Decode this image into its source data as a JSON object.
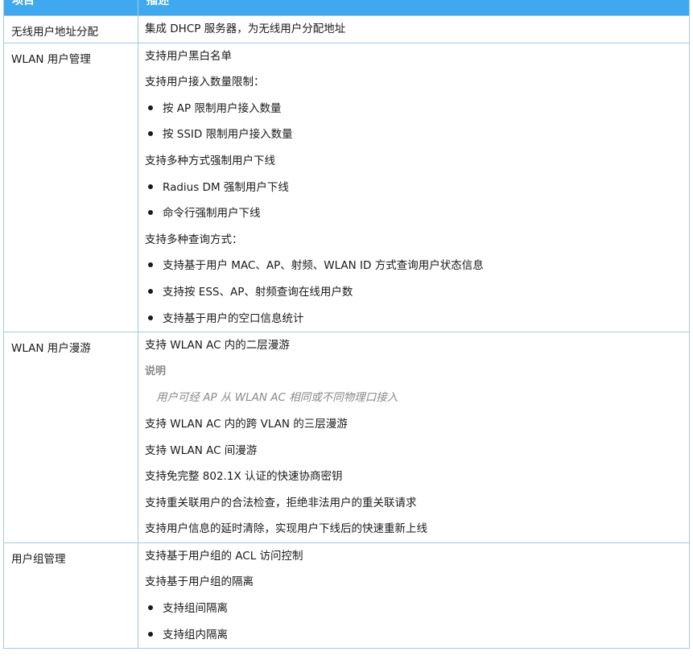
{
  "header": {
    "col_item": "项目",
    "col_desc": "描述"
  },
  "rows": [
    {
      "item": "无线用户地址分配",
      "lines": [
        {
          "type": "text",
          "text": "集成 DHCP 服务器，为无线用户分配地址"
        }
      ]
    },
    {
      "item": "WLAN 用户管理",
      "lines": [
        {
          "type": "text",
          "text": "支持用户黑白名单"
        },
        {
          "type": "text",
          "text": "支持用户接入数量限制："
        },
        {
          "type": "bullet",
          "text": "按 AP 限制用户接入数量"
        },
        {
          "type": "bullet",
          "text": "按 SSID 限制用户接入数量"
        },
        {
          "type": "text",
          "text": "支持多种方式强制用户下线"
        },
        {
          "type": "bullet",
          "text": "Radius DM 强制用户下线"
        },
        {
          "type": "bullet",
          "text": "命令行强制用户下线"
        },
        {
          "type": "text",
          "text": "支持多种查询方式："
        },
        {
          "type": "bullet",
          "text": "支持基于用户 MAC、AP、射频、WLAN ID 方式查询用户状态信息"
        },
        {
          "type": "bullet",
          "text": "支持按 ESS、AP、射频查询在线用户数"
        },
        {
          "type": "bullet",
          "text": "支持基于用户的空口信息统计"
        }
      ]
    },
    {
      "item": "WLAN 用户漫游",
      "lines": [
        {
          "type": "text",
          "text": "支持 WLAN AC 内的二层漫游"
        },
        {
          "type": "note-title",
          "text": "说明"
        },
        {
          "type": "note-body",
          "text": "用户可经 AP 从 WLAN AC 相同或不同物理口接入"
        },
        {
          "type": "text",
          "text": "支持 WLAN AC 内的跨 VLAN 的三层漫游"
        },
        {
          "type": "text",
          "text": "支持 WLAN AC 间漫游"
        },
        {
          "type": "text",
          "text": "支持免完整 802.1X 认证的快速协商密钥"
        },
        {
          "type": "text",
          "text": "支持重关联用户的合法检查，拒绝非法用户的重关联请求"
        },
        {
          "type": "text",
          "text": "支持用户信息的延时清除，实现用户下线后的快速重新上线"
        }
      ]
    },
    {
      "item": "用户组管理",
      "lines": [
        {
          "type": "text",
          "text": "支持基于用户组的 ACL 访问控制"
        },
        {
          "type": "text",
          "text": "支持基于用户组的隔离"
        },
        {
          "type": "bullet",
          "text": "支持组间隔离"
        },
        {
          "type": "bullet",
          "text": "支持组内隔离"
        }
      ]
    }
  ]
}
